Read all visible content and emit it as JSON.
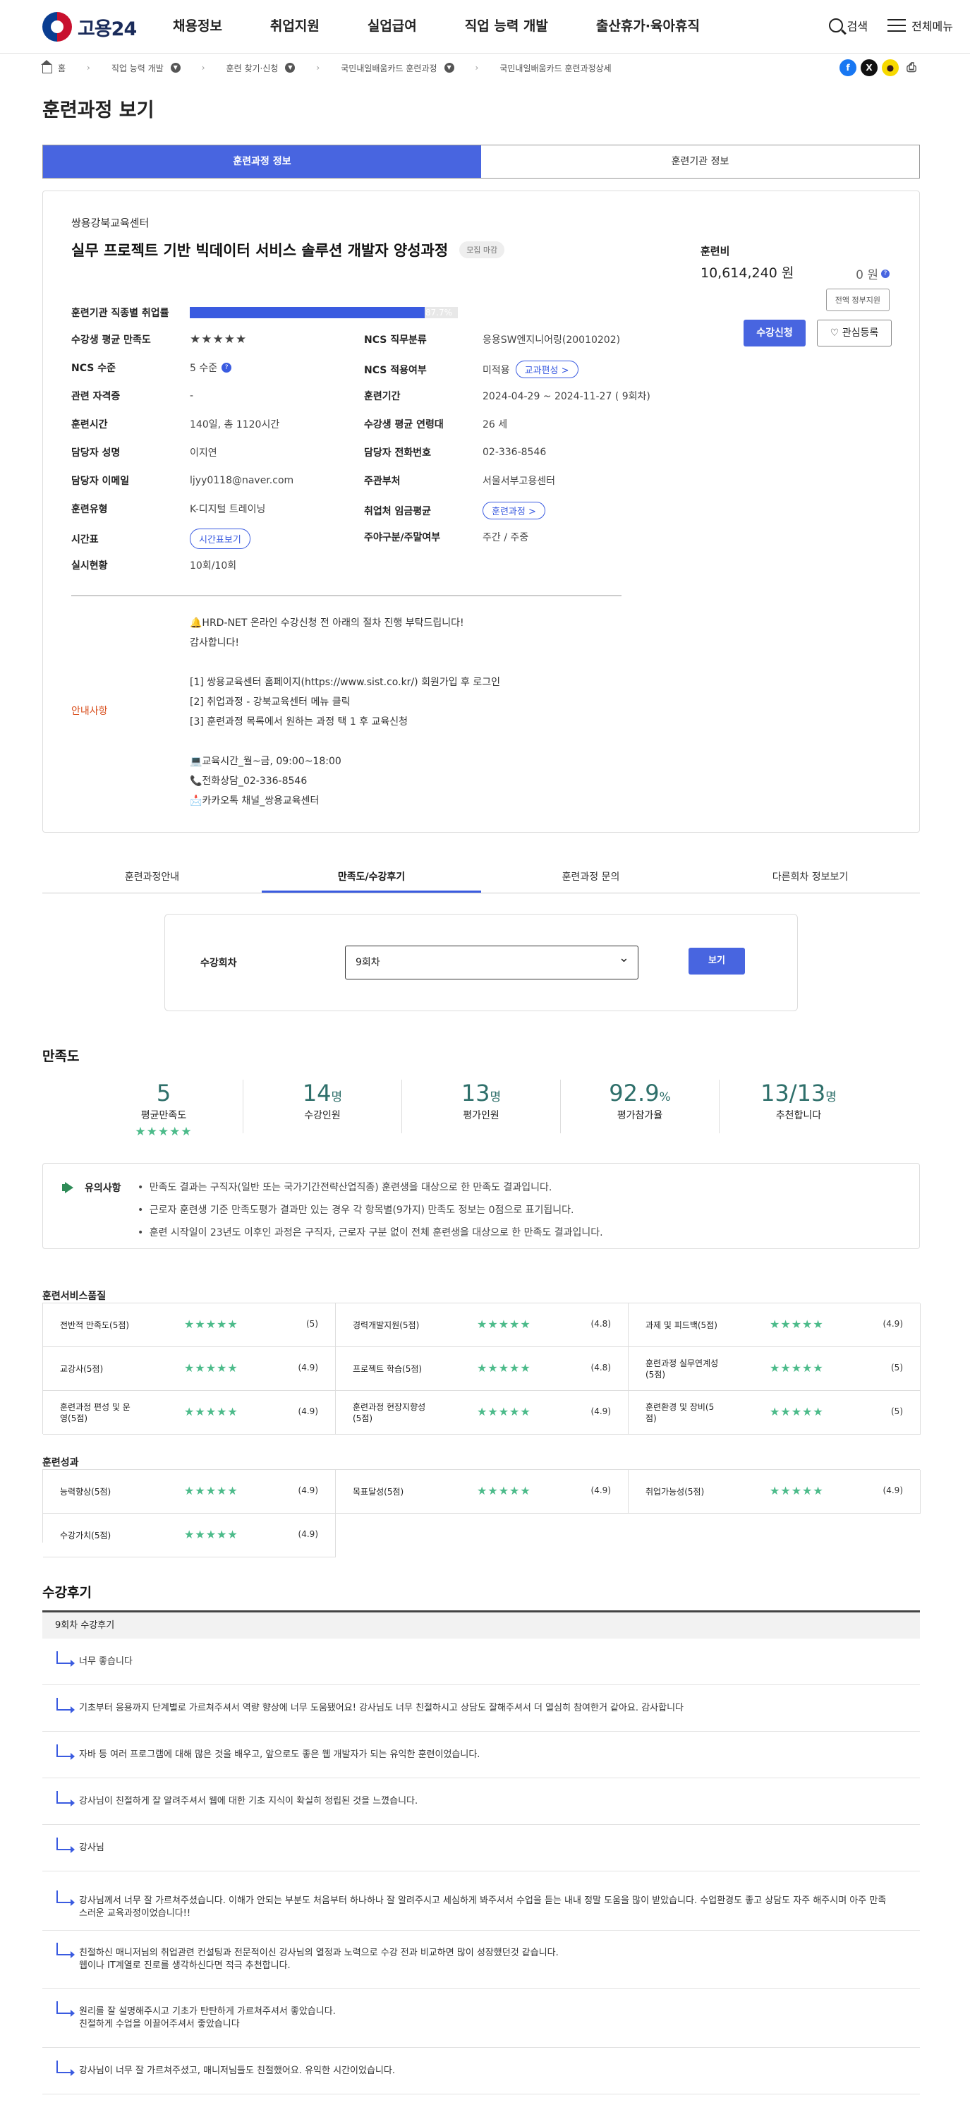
{
  "header": {
    "logo_text": "고용24",
    "menu": [
      "채용정보",
      "취업지원",
      "실업급여",
      "직업 능력 개발",
      "출산휴가·육아휴직"
    ],
    "search_label": "검색",
    "allmenu_label": "전체메뉴"
  },
  "breadcrumb": [
    "홈",
    "직업 능력 개발",
    "훈련 찾기·신청",
    "국민내일배움카드 훈련과정",
    "국민내일배움카드 훈련과정상세"
  ],
  "page_title": "훈련과정 보기",
  "main_tabs": [
    "훈련과정 정보",
    "훈련기관 정보"
  ],
  "course": {
    "org": "쌍용강북교육센터",
    "title": "실무 프로젝트 기반 빅데이터 서비스 솔루션 개발자 양성과정",
    "status_tag": "모집 마감",
    "fee_label": "훈련비",
    "fee_value": "10,614,240 원",
    "self_pay": "0 원",
    "gov_support_label": "전액 정부지원",
    "apply_label": "수강신청",
    "fav_label": "♡ 관심등록",
    "employment_rate_label": "훈련기관 직종별 취업률",
    "employment_rate": "87.7%",
    "employment_rate_value": 0.877,
    "fields": {
      "satisfaction_k": "수강생 평균 만족도",
      "satisfaction_v": "★★★★★",
      "ncs_cat_k": "NCS 직무분류",
      "ncs_cat_v": "응용SW엔지니어링(20010202)",
      "ncs_level_k": "NCS 수준",
      "ncs_level_v": "5 수준",
      "ncs_apply_k": "NCS 적용여부",
      "ncs_apply_v": "미적용",
      "ncs_apply_pill": "교과편성 >",
      "cert_k": "관련 자격증",
      "cert_v": "-",
      "period_k": "훈련기간",
      "period_v": "2024-04-29 ~ 2024-11-27 ( 9회차)",
      "hours_k": "훈련시간",
      "hours_v": "140일, 총 1120시간",
      "age_k": "수강생 평균 연령대",
      "age_v": "26 세",
      "manager_k": "담당자 성명",
      "manager_v": "이지연",
      "phone_k": "담당자 전화번호",
      "phone_v": "02-336-8546",
      "email_k": "담당자 이메일",
      "email_v": "ljyy0118@naver.com",
      "dept_k": "주관부처",
      "dept_v": "서울서부고용센터",
      "type_k": "훈련유형",
      "type_v": "K-디지털 트레이닝",
      "wage_k": "취업처 임금평균",
      "wage_pill": "훈련과정 >",
      "timetable_k": "시간표",
      "timetable_pill": "시간표보기",
      "daynight_k": "주야구분/주말여부",
      "daynight_v": "주간 / 주중",
      "status_k": "실시현황",
      "status_v": "10회/10회"
    },
    "notice_label": "안내사항",
    "notice_text": "🔔HRD-NET 온라인 수강신청 전 아래의 절차 진행 부탁드립니다!\n감사합니다!\n\n[1] 쌍용교육센터 홈페이지(https://www.sist.co.kr/) 회원가입 후 로그인\n[2] 취업과정 - 강북교육센터 메뉴 클릭\n[3] 훈련과정 목록에서 원하는 과정 택 1 후 교육신청\n\n💻교육시간_월~금, 09:00~18:00\n📞전화상담_02-336-8546\n📩카카오톡 채널_쌍용교육센터"
  },
  "sub_tabs": [
    "훈련과정안내",
    "만족도/수강후기",
    "훈련과정 문의",
    "다른회차 정보보기"
  ],
  "round_select": {
    "label": "수강회차",
    "value": "9회차",
    "button": "보기"
  },
  "satisfaction": {
    "title": "만족도",
    "stats": [
      {
        "num": "5",
        "unit": "",
        "label": "평균만족도"
      },
      {
        "num": "14",
        "unit": "명",
        "label": "수강인원"
      },
      {
        "num": "13",
        "unit": "명",
        "label": "평가인원"
      },
      {
        "num": "92.9",
        "unit": "%",
        "label": "평가참가율"
      },
      {
        "num": "13/13",
        "unit": "명",
        "label": "추천합니다"
      }
    ],
    "avg_stars": "★★★★★",
    "caution_title": "유의사항",
    "caution": [
      "만족도 결과는 구직자(일반 또는 국가기간전략산업직종) 훈련생을 대상으로 한 만족도 결과입니다.",
      "근로자 훈련생 기준 만족도평가 결과만 있는 경우 각 항목별(9가지) 만족도 정보는 0점으로 표기됩니다.",
      "훈련 시작일이 23년도 이후인 과정은 구직자, 근로자 구분 없이 전체 훈련생을 대상으로 한 만족도 결과입니다."
    ]
  },
  "quality": {
    "title": "훈련서비스품질",
    "items": [
      {
        "name": "전반적 만족도(5점)",
        "score": "(5)"
      },
      {
        "name": "경력개발지원(5점)",
        "score": "(4.8)"
      },
      {
        "name": "과제 및 피드백(5점)",
        "score": "(4.9)"
      },
      {
        "name": "교강사(5점)",
        "score": "(4.9)"
      },
      {
        "name": "프로젝트 학습(5점)",
        "score": "(4.8)"
      },
      {
        "name": "훈련과정 실무연계성(5점)",
        "score": "(5)"
      },
      {
        "name": "훈련과정 편성 및 운영(5점)",
        "score": "(4.9)"
      },
      {
        "name": "훈련과정 현장지향성(5점)",
        "score": "(4.9)"
      },
      {
        "name": "훈련환경 및 장비(5점)",
        "score": "(5)"
      }
    ]
  },
  "outcome": {
    "title": "훈련성과",
    "items": [
      {
        "name": "능력향상(5점)",
        "score": "(4.9)"
      },
      {
        "name": "목표달성(5점)",
        "score": "(4.9)"
      },
      {
        "name": "취업가능성(5점)",
        "score": "(4.9)"
      },
      {
        "name": "수강가치(5점)",
        "score": "(4.9)"
      }
    ]
  },
  "reviews": {
    "title": "수강후기",
    "head": "9회차 수강후기",
    "items": [
      "너무 좋습니다",
      "기초부터 응용까지 단계별로 가르쳐주셔서 역량 향상에 너무 도움됐어요! 강사님도 너무 친절하시고 상담도 잘해주셔서 더 열심히 참여한거 같아요. 감사합니다",
      "자바 등 여러 프로그램에 대해 많은 것을 배우고, 앞으로도 좋은 웹 개발자가 되는 유익한 훈련이었습니다.",
      "강사님이 친절하게 잘 알려주셔서 웹에 대한 기초 지식이 확실히 정립된 것을 느꼈습니다.",
      "강사님",
      "강사님께서 너무 잘 가르쳐주셨습니다. 이해가 안되는 부분도 처음부터 하나하나 잘 알려주시고 세심하게 봐주셔서 수업을 듣는 내내 정말 도움을 많이 받았습니다. 수업환경도 좋고 상담도 자주 해주시며 아주 만족스러운 교육과정이었습니다!!",
      "친절하신 매니저님의 취업관련 컨설팅과 전문적이신 강사님의 열정과 노력으로 수강 전과 비교하면 많이 성장했던것 같습니다.\n웹이나 IT계열로 진로를 생각하신다면 적극 추천합니다.",
      "원리를 잘 설명해주시고 기초가 탄탄하게 가르쳐주셔서 좋았습니다.\n친절하게 수업을 이끌어주셔서 좋았습니다",
      "강사님이 너무 잘 가르쳐주셨고, 매니저님들도 친절했어요. 유익한 시간이었습니다."
    ]
  },
  "colors": {
    "accent": "#4865e0",
    "star": "#4cbb8a",
    "stat": "#2e6f6a",
    "notice": "#d9501f"
  }
}
